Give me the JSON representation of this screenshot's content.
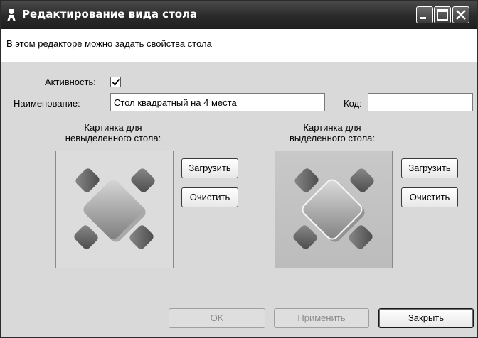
{
  "window": {
    "title": "Редактирование вида стола",
    "icon": "person-icon",
    "controls": {
      "minimize": "minimize-icon",
      "maximize": "maximize-icon",
      "close": "close-icon"
    }
  },
  "info": {
    "text": "В этом редакторе можно задать свойства стола"
  },
  "form": {
    "active_label": "Активность:",
    "active_checked": true,
    "name_label": "Наименование:",
    "name_value": "Стол квадратный на 4 места",
    "code_label": "Код:",
    "code_value": ""
  },
  "images": {
    "unselected_caption_line1": "Картинка для",
    "unselected_caption_line2": "невыделенного стола:",
    "selected_caption_line1": "Картинка для",
    "selected_caption_line2": "выделенного стола:",
    "load_label": "Загрузить",
    "clear_label": "Очистить"
  },
  "buttons": {
    "ok": "OK",
    "apply": "Применить",
    "close": "Закрыть"
  },
  "colors": {
    "titlebar": "#2a2a2a",
    "dialog_bg": "#d9d9d9",
    "info_bg": "#ffffff"
  }
}
